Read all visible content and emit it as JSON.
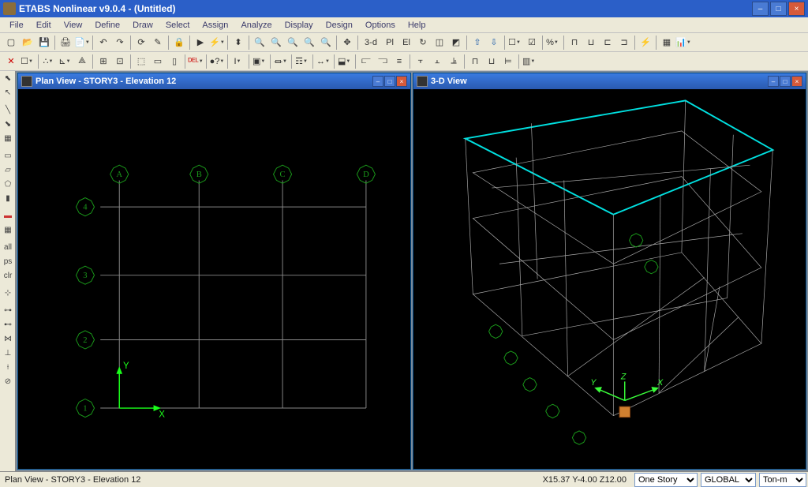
{
  "app": {
    "title": "ETABS Nonlinear v9.0.4 - (Untitled)"
  },
  "menu": {
    "items": [
      "File",
      "Edit",
      "View",
      "Define",
      "Draw",
      "Select",
      "Assign",
      "Analyze",
      "Display",
      "Design",
      "Options",
      "Help"
    ]
  },
  "toolbar1": {
    "t3d": "3-d",
    "pl": "Pl",
    "el": "El"
  },
  "panes": {
    "plan": {
      "title": "Plan View - STORY3 - Elevation 12"
    },
    "v3d": {
      "title": "3-D View"
    }
  },
  "plan": {
    "cols": [
      "A",
      "B",
      "C",
      "D"
    ],
    "rows": [
      "4",
      "3",
      "2",
      "1"
    ],
    "axisX": "X",
    "axisY": "Y"
  },
  "v3d": {
    "axX": "X",
    "axY": "Y",
    "axZ": "Z"
  },
  "status": {
    "left": "Plan View - STORY3 - Elevation 12",
    "coords": "X15.37 Y-4.00 Z12.00",
    "storySel": "One Story",
    "coordSel": "GLOBAL",
    "unitSel": "Ton-m"
  }
}
